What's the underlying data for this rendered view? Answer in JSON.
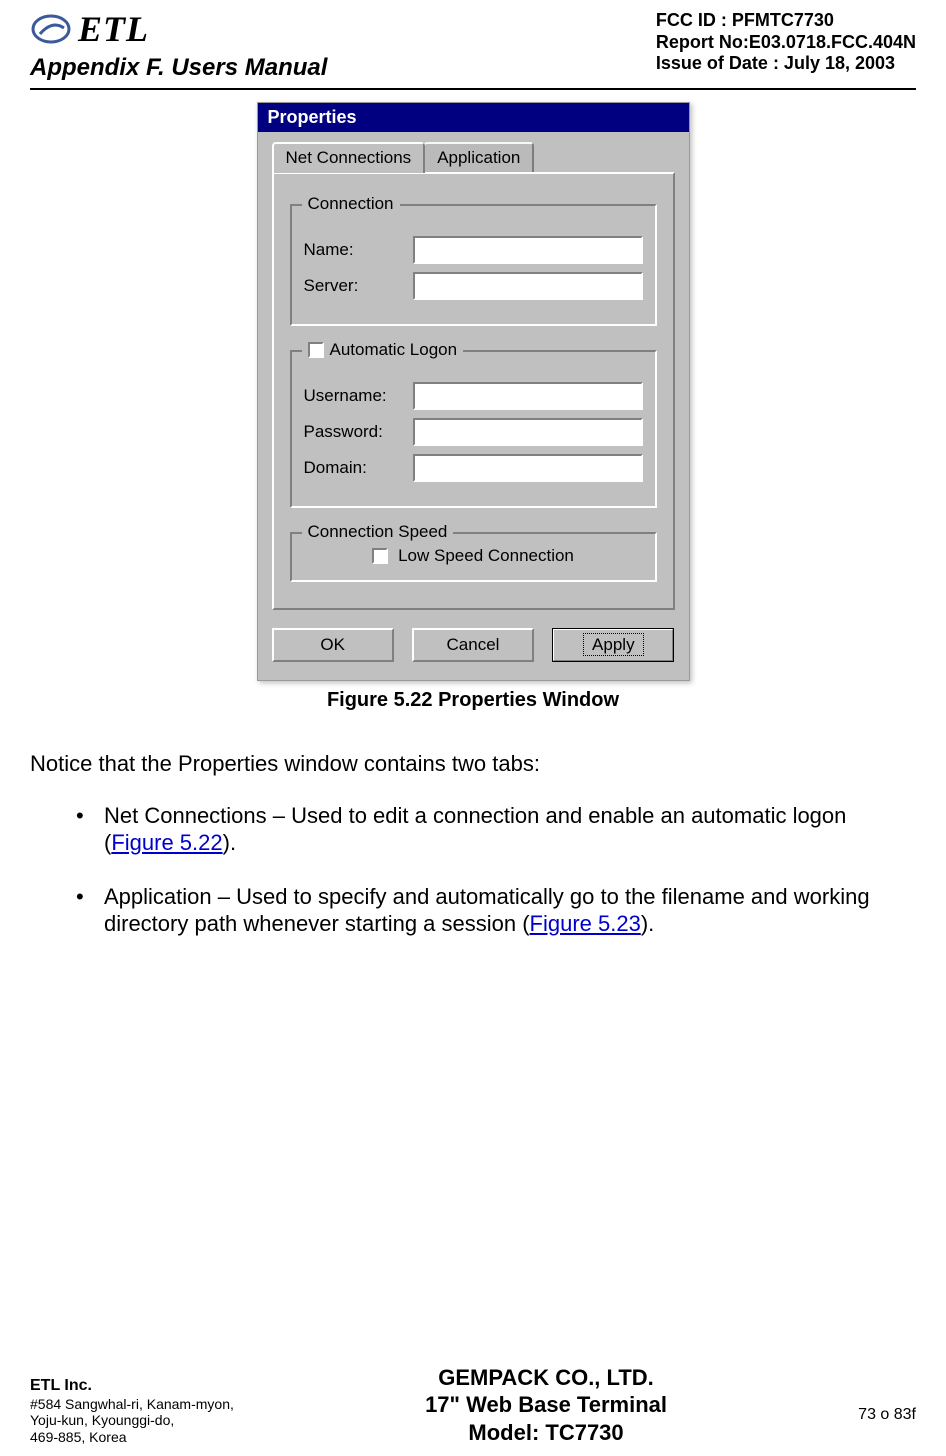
{
  "header": {
    "logo_text": "ETL",
    "appendix": "Appendix F.  Users Manual",
    "fcc_id": "FCC ID : PFMTC7730",
    "report_no": "Report No:E03.0718.FCC.404N",
    "issue_date": "Issue of Date : July 18, 2003"
  },
  "dialog": {
    "title": "Properties",
    "tabs": {
      "net": "Net Connections",
      "app": "Application"
    },
    "group_connection": "Connection",
    "name_label": "Name:",
    "server_label": "Server:",
    "group_autologon": "Automatic Logon",
    "username_label": "Username:",
    "password_label": "Password:",
    "domain_label": "Domain:",
    "group_speed": "Connection Speed",
    "low_speed_label": "Low Speed Connection",
    "ok": "OK",
    "cancel": "Cancel",
    "apply": "Apply"
  },
  "figure_caption": "Figure 5.22    Properties Window",
  "body": {
    "intro": "Notice that the Properties window contains two tabs:",
    "bullet1_pre": "Net Connections  – Used to edit a connection and enable an automatic logon (",
    "bullet1_ref": "Figure 5.22",
    "bullet1_post": ").",
    "bullet2_pre": "Application – Used to specify and automatically go to the filename and working directory path whenever starting a session (",
    "bullet2_ref": "Figure 5.23",
    "bullet2_post": ")."
  },
  "footer": {
    "company": "ETL Inc.",
    "addr1": "#584 Sangwhal-ri, Kanam-myon,",
    "addr2": "Yoju-kun, Kyounggi-do,",
    "addr3": "469-885, Korea",
    "center1": "GEMPACK CO., LTD.",
    "center2": "17\" Web Base Terminal",
    "center3": "Model: TC7730",
    "page_no": "73 o 83f"
  }
}
